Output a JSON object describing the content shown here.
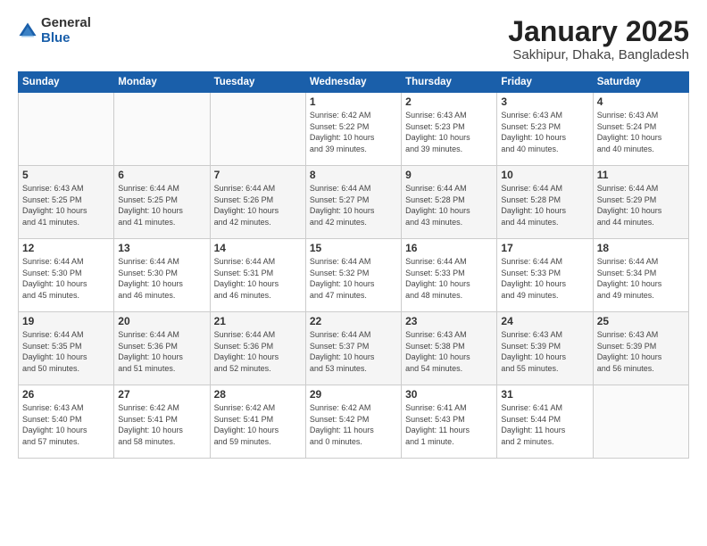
{
  "logo": {
    "general": "General",
    "blue": "Blue"
  },
  "title": {
    "month": "January 2025",
    "location": "Sakhipur, Dhaka, Bangladesh"
  },
  "days_header": [
    "Sunday",
    "Monday",
    "Tuesday",
    "Wednesday",
    "Thursday",
    "Friday",
    "Saturday"
  ],
  "weeks": [
    [
      {
        "num": "",
        "info": ""
      },
      {
        "num": "",
        "info": ""
      },
      {
        "num": "",
        "info": ""
      },
      {
        "num": "1",
        "info": "Sunrise: 6:42 AM\nSunset: 5:22 PM\nDaylight: 10 hours\nand 39 minutes."
      },
      {
        "num": "2",
        "info": "Sunrise: 6:43 AM\nSunset: 5:23 PM\nDaylight: 10 hours\nand 39 minutes."
      },
      {
        "num": "3",
        "info": "Sunrise: 6:43 AM\nSunset: 5:23 PM\nDaylight: 10 hours\nand 40 minutes."
      },
      {
        "num": "4",
        "info": "Sunrise: 6:43 AM\nSunset: 5:24 PM\nDaylight: 10 hours\nand 40 minutes."
      }
    ],
    [
      {
        "num": "5",
        "info": "Sunrise: 6:43 AM\nSunset: 5:25 PM\nDaylight: 10 hours\nand 41 minutes."
      },
      {
        "num": "6",
        "info": "Sunrise: 6:44 AM\nSunset: 5:25 PM\nDaylight: 10 hours\nand 41 minutes."
      },
      {
        "num": "7",
        "info": "Sunrise: 6:44 AM\nSunset: 5:26 PM\nDaylight: 10 hours\nand 42 minutes."
      },
      {
        "num": "8",
        "info": "Sunrise: 6:44 AM\nSunset: 5:27 PM\nDaylight: 10 hours\nand 42 minutes."
      },
      {
        "num": "9",
        "info": "Sunrise: 6:44 AM\nSunset: 5:28 PM\nDaylight: 10 hours\nand 43 minutes."
      },
      {
        "num": "10",
        "info": "Sunrise: 6:44 AM\nSunset: 5:28 PM\nDaylight: 10 hours\nand 44 minutes."
      },
      {
        "num": "11",
        "info": "Sunrise: 6:44 AM\nSunset: 5:29 PM\nDaylight: 10 hours\nand 44 minutes."
      }
    ],
    [
      {
        "num": "12",
        "info": "Sunrise: 6:44 AM\nSunset: 5:30 PM\nDaylight: 10 hours\nand 45 minutes."
      },
      {
        "num": "13",
        "info": "Sunrise: 6:44 AM\nSunset: 5:30 PM\nDaylight: 10 hours\nand 46 minutes."
      },
      {
        "num": "14",
        "info": "Sunrise: 6:44 AM\nSunset: 5:31 PM\nDaylight: 10 hours\nand 46 minutes."
      },
      {
        "num": "15",
        "info": "Sunrise: 6:44 AM\nSunset: 5:32 PM\nDaylight: 10 hours\nand 47 minutes."
      },
      {
        "num": "16",
        "info": "Sunrise: 6:44 AM\nSunset: 5:33 PM\nDaylight: 10 hours\nand 48 minutes."
      },
      {
        "num": "17",
        "info": "Sunrise: 6:44 AM\nSunset: 5:33 PM\nDaylight: 10 hours\nand 49 minutes."
      },
      {
        "num": "18",
        "info": "Sunrise: 6:44 AM\nSunset: 5:34 PM\nDaylight: 10 hours\nand 49 minutes."
      }
    ],
    [
      {
        "num": "19",
        "info": "Sunrise: 6:44 AM\nSunset: 5:35 PM\nDaylight: 10 hours\nand 50 minutes."
      },
      {
        "num": "20",
        "info": "Sunrise: 6:44 AM\nSunset: 5:36 PM\nDaylight: 10 hours\nand 51 minutes."
      },
      {
        "num": "21",
        "info": "Sunrise: 6:44 AM\nSunset: 5:36 PM\nDaylight: 10 hours\nand 52 minutes."
      },
      {
        "num": "22",
        "info": "Sunrise: 6:44 AM\nSunset: 5:37 PM\nDaylight: 10 hours\nand 53 minutes."
      },
      {
        "num": "23",
        "info": "Sunrise: 6:43 AM\nSunset: 5:38 PM\nDaylight: 10 hours\nand 54 minutes."
      },
      {
        "num": "24",
        "info": "Sunrise: 6:43 AM\nSunset: 5:39 PM\nDaylight: 10 hours\nand 55 minutes."
      },
      {
        "num": "25",
        "info": "Sunrise: 6:43 AM\nSunset: 5:39 PM\nDaylight: 10 hours\nand 56 minutes."
      }
    ],
    [
      {
        "num": "26",
        "info": "Sunrise: 6:43 AM\nSunset: 5:40 PM\nDaylight: 10 hours\nand 57 minutes."
      },
      {
        "num": "27",
        "info": "Sunrise: 6:42 AM\nSunset: 5:41 PM\nDaylight: 10 hours\nand 58 minutes."
      },
      {
        "num": "28",
        "info": "Sunrise: 6:42 AM\nSunset: 5:41 PM\nDaylight: 10 hours\nand 59 minutes."
      },
      {
        "num": "29",
        "info": "Sunrise: 6:42 AM\nSunset: 5:42 PM\nDaylight: 11 hours\nand 0 minutes."
      },
      {
        "num": "30",
        "info": "Sunrise: 6:41 AM\nSunset: 5:43 PM\nDaylight: 11 hours\nand 1 minute."
      },
      {
        "num": "31",
        "info": "Sunrise: 6:41 AM\nSunset: 5:44 PM\nDaylight: 11 hours\nand 2 minutes."
      },
      {
        "num": "",
        "info": ""
      }
    ]
  ]
}
